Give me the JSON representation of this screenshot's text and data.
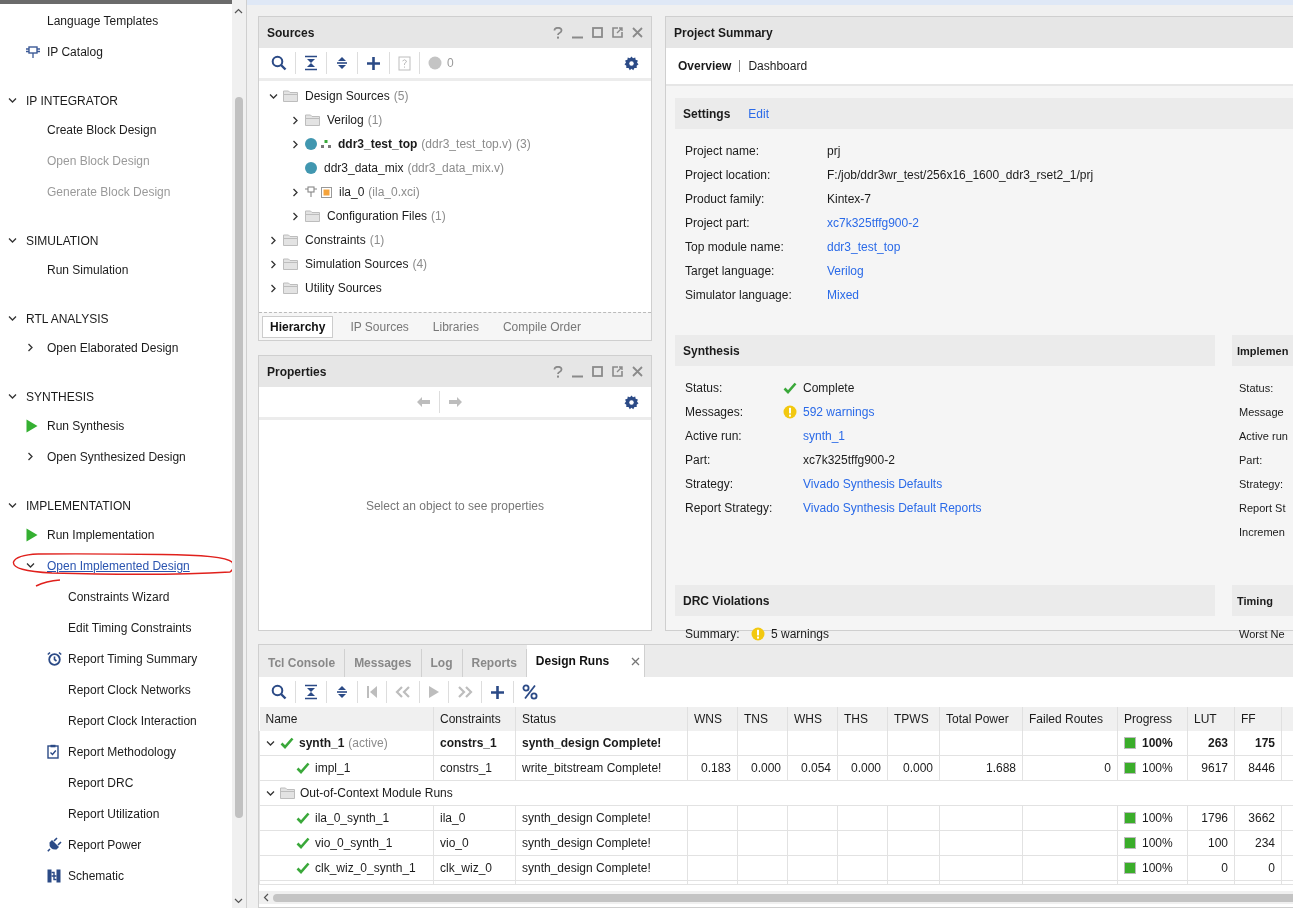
{
  "nav": {
    "sections": [
      {
        "items": [
          {
            "label": "Language Templates",
            "kind": "plain",
            "disabled": false,
            "marked": false
          },
          {
            "label": "IP Catalog",
            "kind": "catalog",
            "disabled": false,
            "marked": false
          }
        ]
      },
      {
        "heading": "IP INTEGRATOR",
        "expanded": true,
        "items": [
          {
            "label": "Create Block Design",
            "kind": "plain",
            "disabled": false,
            "marked": false
          },
          {
            "label": "Open Block Design",
            "kind": "plain",
            "disabled": true,
            "marked": false
          },
          {
            "label": "Generate Block Design",
            "kind": "plain",
            "disabled": true,
            "marked": false
          }
        ]
      },
      {
        "heading": "SIMULATION",
        "expanded": true,
        "items": [
          {
            "label": "Run Simulation",
            "kind": "plain",
            "disabled": false,
            "marked": false
          }
        ]
      },
      {
        "heading": "RTL ANALYSIS",
        "expanded": true,
        "items": [
          {
            "label": "Open Elaborated Design",
            "kind": "branch",
            "expanded": false,
            "disabled": false,
            "marked": false
          }
        ]
      },
      {
        "heading": "SYNTHESIS",
        "expanded": true,
        "items": [
          {
            "label": "Run Synthesis",
            "kind": "run",
            "disabled": false,
            "marked": false
          },
          {
            "label": "Open Synthesized Design",
            "kind": "branch",
            "expanded": false,
            "disabled": false,
            "marked": false
          }
        ]
      },
      {
        "heading": "IMPLEMENTATION",
        "expanded": true,
        "items": [
          {
            "label": "Run Implementation",
            "kind": "run",
            "disabled": false,
            "marked": false
          },
          {
            "label": "Open Implemented Design",
            "kind": "branch",
            "expanded": true,
            "disabled": false,
            "marked": true,
            "children": [
              {
                "label": "Constraints Wizard",
                "kind": "plain",
                "disabled": false,
                "marked": false
              },
              {
                "label": "Edit Timing Constraints",
                "kind": "plain",
                "disabled": false,
                "marked": false
              },
              {
                "label": "Report Timing Summary",
                "kind": "timing",
                "disabled": false,
                "marked": false
              },
              {
                "label": "Report Clock Networks",
                "kind": "plain",
                "disabled": false,
                "marked": false
              },
              {
                "label": "Report Clock Interaction",
                "kind": "plain",
                "disabled": false,
                "marked": false
              },
              {
                "label": "Report Methodology",
                "kind": "methodology",
                "disabled": false,
                "marked": false
              },
              {
                "label": "Report DRC",
                "kind": "plain",
                "disabled": false,
                "marked": false
              },
              {
                "label": "Report Utilization",
                "kind": "plain",
                "disabled": false,
                "marked": false
              },
              {
                "label": "Report Power",
                "kind": "power",
                "disabled": false,
                "marked": false
              },
              {
                "label": "Schematic",
                "kind": "schematic",
                "disabled": false,
                "marked": false
              }
            ]
          }
        ]
      }
    ]
  },
  "sources": {
    "title": "Sources",
    "toolbar": [
      {
        "kind": "search",
        "disabled": false
      },
      {
        "kind": "collapse",
        "disabled": false
      },
      {
        "kind": "expand",
        "disabled": false
      },
      {
        "kind": "add",
        "disabled": false
      },
      {
        "kind": "help",
        "disabled": true
      },
      {
        "kind": "status",
        "disabled": true,
        "text": "0"
      },
      {
        "kind": "settings",
        "disabled": false
      }
    ],
    "tree": [
      {
        "label": "Design Sources",
        "count": "(5)",
        "kind": "folder",
        "bold": false,
        "expanded": true,
        "children": [
          {
            "label": "Verilog",
            "count": "(1)",
            "kind": "folder",
            "bold": false,
            "expanded": false
          },
          {
            "label": "ddr3_test_top",
            "detail": "(ddr3_test_top.v)",
            "count": "(3)",
            "kind": "top",
            "bold": true,
            "expanded": false
          },
          {
            "label": "ddr3_data_mix",
            "detail": "(ddr3_data_mix.v)",
            "kind": "module",
            "bold": false
          },
          {
            "label": "ila_0",
            "detail": "(ila_0.xci)",
            "kind": "ip",
            "bold": false,
            "expanded": false
          },
          {
            "label": "Configuration Files",
            "count": "(1)",
            "kind": "folder",
            "bold": false,
            "expanded": false
          }
        ]
      },
      {
        "label": "Constraints",
        "count": "(1)",
        "kind": "folder",
        "bold": false,
        "expanded": false
      },
      {
        "label": "Simulation Sources",
        "count": "(4)",
        "kind": "folder",
        "bold": false,
        "expanded": false
      },
      {
        "label": "Utility Sources",
        "kind": "folder",
        "bold": false,
        "expanded": false
      }
    ],
    "tabs": [
      {
        "label": "Hierarchy",
        "selected": true
      },
      {
        "label": "IP Sources",
        "selected": false
      },
      {
        "label": "Libraries",
        "selected": false
      },
      {
        "label": "Compile Order",
        "selected": false
      }
    ]
  },
  "properties": {
    "title": "Properties",
    "toolbar": [
      {
        "kind": "back",
        "disabled": true
      },
      {
        "kind": "forward",
        "disabled": true
      },
      {
        "kind": "settings",
        "disabled": false
      }
    ],
    "empty_message": "Select an object to see properties"
  },
  "project_summary": {
    "title": "Project Summary",
    "tabs": [
      {
        "label": "Overview",
        "selected": true
      },
      {
        "label": "Dashboard",
        "selected": false
      }
    ],
    "settings": {
      "title": "Settings",
      "action": "Edit",
      "rows": [
        {
          "label": "Project name:",
          "value": "prj",
          "link": false
        },
        {
          "label": "Project location:",
          "value": "F:/job/ddr3wr_test/256x16_1600_ddr3_rset2_1/prj",
          "link": false
        },
        {
          "label": "Product family:",
          "value": "Kintex-7",
          "link": false
        },
        {
          "label": "Project part:",
          "value": "xc7k325tffg900-2",
          "link": true
        },
        {
          "label": "Top module name:",
          "value": "ddr3_test_top",
          "link": true
        },
        {
          "label": "Target language:",
          "value": "Verilog",
          "link": true
        },
        {
          "label": "Simulator language:",
          "value": "Mixed",
          "link": true
        }
      ]
    },
    "synthesis": {
      "title": "Synthesis",
      "rows": [
        {
          "label": "Status:",
          "value": "Complete",
          "link": false,
          "kind": "ok"
        },
        {
          "label": "Messages:",
          "value": "592 warnings",
          "link": true,
          "kind": "warning"
        },
        {
          "label": "Active run:",
          "value": "synth_1",
          "link": true,
          "kind": "plain"
        },
        {
          "label": "Part:",
          "value": "xc7k325tffg900-2",
          "link": false,
          "kind": "plain"
        },
        {
          "label": "Strategy:",
          "value": "Vivado Synthesis Defaults",
          "link": true,
          "kind": "plain"
        },
        {
          "label": "Report Strategy:",
          "value": "Vivado Synthesis Default Reports",
          "link": true,
          "kind": "plain"
        }
      ]
    },
    "implementation": {
      "title": "Implemen",
      "labels": [
        "Status:",
        "Message",
        "Active run",
        "Part:",
        "Strategy:",
        "Report St",
        "Incremen"
      ]
    },
    "drc": {
      "title": "DRC Violations",
      "rows": [
        {
          "label": "Summary:",
          "value": "5 warnings",
          "link": false,
          "kind": "warning"
        }
      ]
    },
    "timing": {
      "title": "Timing",
      "labels": [
        "Worst Ne"
      ]
    }
  },
  "runs_panel": {
    "tabs": [
      {
        "label": "Tcl Console",
        "selected": false,
        "closable": false
      },
      {
        "label": "Messages",
        "selected": false,
        "closable": false
      },
      {
        "label": "Log",
        "selected": false,
        "closable": false
      },
      {
        "label": "Reports",
        "selected": false,
        "closable": false
      },
      {
        "label": "Design Runs",
        "selected": true,
        "closable": true
      }
    ],
    "toolbar": [
      {
        "kind": "search",
        "disabled": false
      },
      {
        "kind": "collapse",
        "disabled": false
      },
      {
        "kind": "expand",
        "disabled": false
      },
      {
        "kind": "first",
        "disabled": true
      },
      {
        "kind": "previous",
        "disabled": true
      },
      {
        "kind": "play",
        "disabled": true
      },
      {
        "kind": "next",
        "disabled": true
      },
      {
        "kind": "add",
        "disabled": false
      },
      {
        "kind": "percent",
        "disabled": false
      }
    ],
    "columns": [
      "Name",
      "Constraints",
      "Status",
      "WNS",
      "TNS",
      "WHS",
      "THS",
      "TPWS",
      "Total Power",
      "Failed Routes",
      "Progress",
      "LUT",
      "FF"
    ],
    "rows": [
      {
        "kind": "run",
        "name": "synth_1",
        "note": "(active)",
        "bold": true,
        "done": true,
        "expanded": true,
        "cells": [
          "constrs_1",
          "synth_design Complete!",
          null,
          null,
          null,
          null,
          null,
          null,
          null
        ],
        "progress": "100%",
        "level": 1,
        "lut": "263",
        "ff": "175",
        "children": [
          {
            "kind": "run",
            "name": "impl_1",
            "bold": false,
            "done": true,
            "cells": [
              "constrs_1",
              "write_bitstream Complete!",
              "0.183",
              "0.000",
              "0.054",
              "0.000",
              "0.000",
              "1.688",
              "0"
            ],
            "progress": "100%",
            "level": 1,
            "lut": "9617",
            "ff": "8446"
          }
        ]
      },
      {
        "kind": "group",
        "name": "Out-of-Context Module Runs",
        "bold": false,
        "expanded": true,
        "children": [
          {
            "kind": "run",
            "name": "ila_0_synth_1",
            "bold": false,
            "done": true,
            "cells": [
              "ila_0",
              "synth_design Complete!",
              null,
              null,
              null,
              null,
              null,
              null,
              null
            ],
            "progress": "100%",
            "level": 1,
            "lut": "1796",
            "ff": "3662"
          },
          {
            "kind": "run",
            "name": "vio_0_synth_1",
            "bold": false,
            "done": true,
            "cells": [
              "vio_0",
              "synth_design Complete!",
              null,
              null,
              null,
              null,
              null,
              null,
              null
            ],
            "progress": "100%",
            "level": 1,
            "lut": "100",
            "ff": "234"
          },
          {
            "kind": "run",
            "name": "clk_wiz_0_synth_1",
            "bold": false,
            "done": true,
            "cells": [
              "clk_wiz_0",
              "synth_design Complete!",
              null,
              null,
              null,
              null,
              null,
              null,
              null
            ],
            "progress": "100%",
            "level": 1,
            "lut": "0",
            "ff": "0"
          }
        ]
      }
    ]
  }
}
